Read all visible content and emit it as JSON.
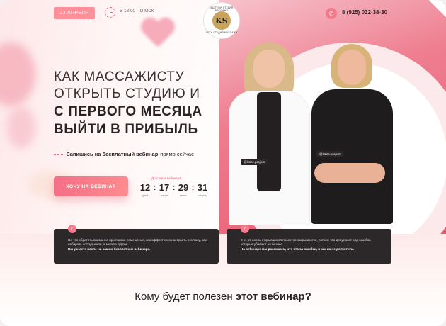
{
  "header": {
    "date": "23 АПРЕЛЯ",
    "time": "В 18:00 ПО МСК",
    "logo_top": "ЧАСТНАЯ СТУДИЯ МАССАЖА",
    "logo_mark": "KS",
    "logo_bottom": "СЕТЬ СТУДИЙ МАССАЖА",
    "phone": "8 (925) 032-38-30"
  },
  "hero": {
    "line1": "КАК МАССАЖИСТУ",
    "line2": "ОТКРЫТЬ СТУДИЮ И",
    "line3": "С ПЕРВОГО МЕСЯЦА",
    "line4": "ВЫЙТИ В ПРИБЫЛЬ",
    "cta_bold": "Запишись на бесплатный вебинар",
    "cta_rest": "прямо сейчас",
    "button": "ХОЧУ НА ВЕБИНАР"
  },
  "timer": {
    "label": "До старта вебинара:",
    "days": "12",
    "hours": "17",
    "minutes": "29",
    "seconds": "31",
    "days_cap": "дней",
    "hours_cap": "часов",
    "minutes_cap": "минут",
    "seconds_cap": "секунд"
  },
  "tags": {
    "left": "@ksize.project",
    "right": "@ksize.project"
  },
  "cards": [
    {
      "text": "На что обратить внимание при поиске помещения, как эффективно настроить рекламу, как набирать сотрудников, и многое другое.",
      "bold": "Вы узнаете после на нашем бесплатном вебинаре."
    },
    {
      "text": "9 из 10 вновь открывшихся проектов закрываются, потому что допускают ряд ошибок, которые убивают их бизнес.",
      "bold": "На вебинаре мы расскажем, что это за ошибки, и как их не допустить."
    }
  ],
  "section": {
    "title_plain": "Кому будет полезен",
    "title_bold": "этот вебинар?"
  }
}
